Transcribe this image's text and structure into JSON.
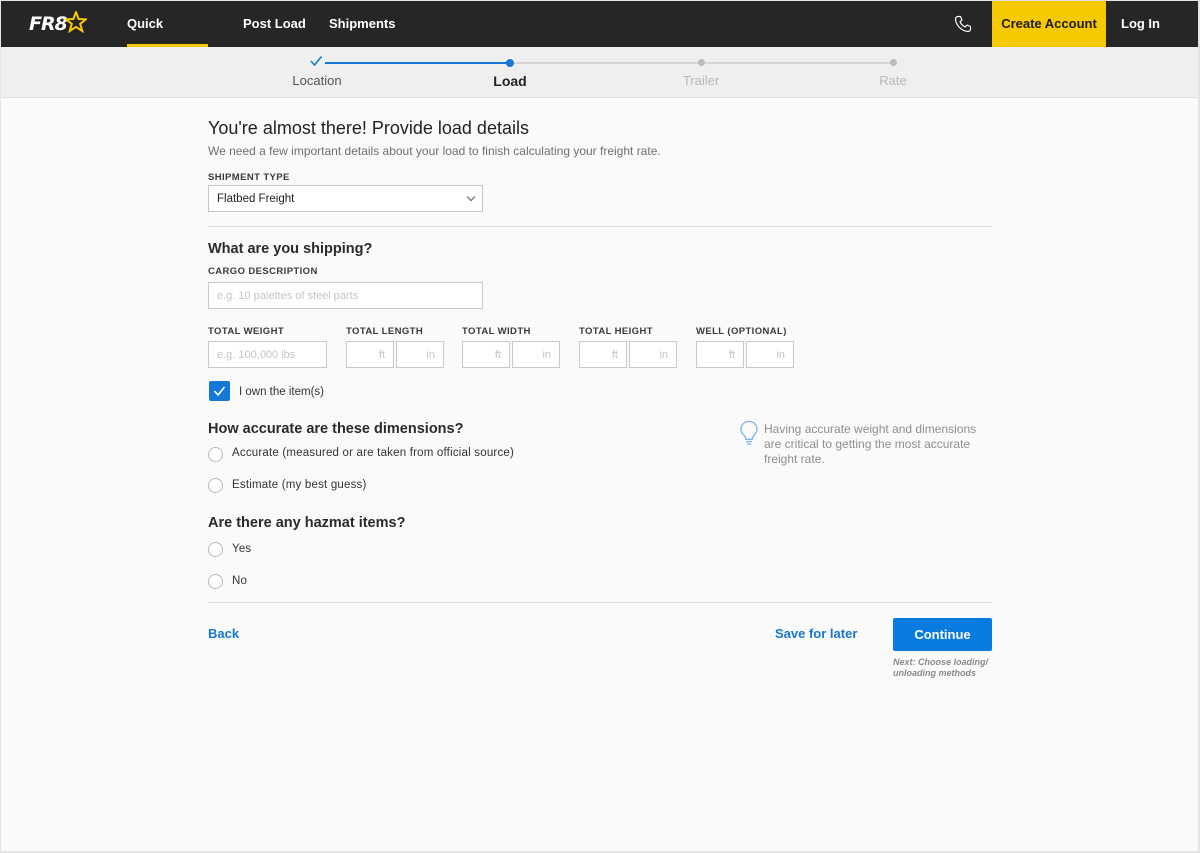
{
  "nav": {
    "logo_text": "FR8",
    "items": [
      {
        "label": "Quick Estimate",
        "active": true
      },
      {
        "label": "Post Load",
        "active": false
      },
      {
        "label": "Shipments",
        "active": false
      }
    ],
    "phone_icon": "phone-icon",
    "create_account_label": "Create Account",
    "login_label": "Log In"
  },
  "steps": [
    {
      "label": "Location",
      "state": "done"
    },
    {
      "label": "Load",
      "state": "current"
    },
    {
      "label": "Trailer",
      "state": "upcoming"
    },
    {
      "label": "Rate",
      "state": "upcoming"
    }
  ],
  "form": {
    "title": "You're almost there! Provide load details",
    "subtitle": "We need a few important details about your load to finish calculating your freight rate.",
    "shipment_type_label": "SHIPMENT TYPE",
    "shipment_type_value": "Flatbed Freight",
    "shipping_heading": "What are you shipping?",
    "cargo_label": "CARGO DESCRIPTION",
    "cargo_placeholder": "e.g. 10 palettes of steel parts",
    "weight_label": "TOTAL WEIGHT",
    "weight_placeholder": "e.g. 100,000 lbs",
    "length_label": "TOTAL LENGTH",
    "width_label": "TOTAL WIDTH",
    "height_label": "TOTAL HEIGHT",
    "well_label": "WELL (OPTIONAL)",
    "unit_ft": "ft",
    "unit_in": "in",
    "own_items_label": "I own the item(s)",
    "own_items_checked": true,
    "accuracy_heading": "How accurate are these dimensions?",
    "accuracy_options": [
      "Accurate (measured or are taken from official source)",
      "Estimate (my best guess)"
    ],
    "tip_text": "Having accurate weight and dimensions are critical to getting the most accurate freight rate.",
    "hazmat_heading": "Are there any hazmat items?",
    "hazmat_options": [
      "Yes",
      "No"
    ],
    "back_label": "Back",
    "save_label": "Save for later",
    "continue_label": "Continue",
    "next_note": "Next: Choose loading/ unloading methods"
  },
  "colors": {
    "nav_bg": "#262626",
    "accent_yellow": "#f7c900",
    "primary_blue": "#0a7be0",
    "link_blue": "#1677cc"
  }
}
